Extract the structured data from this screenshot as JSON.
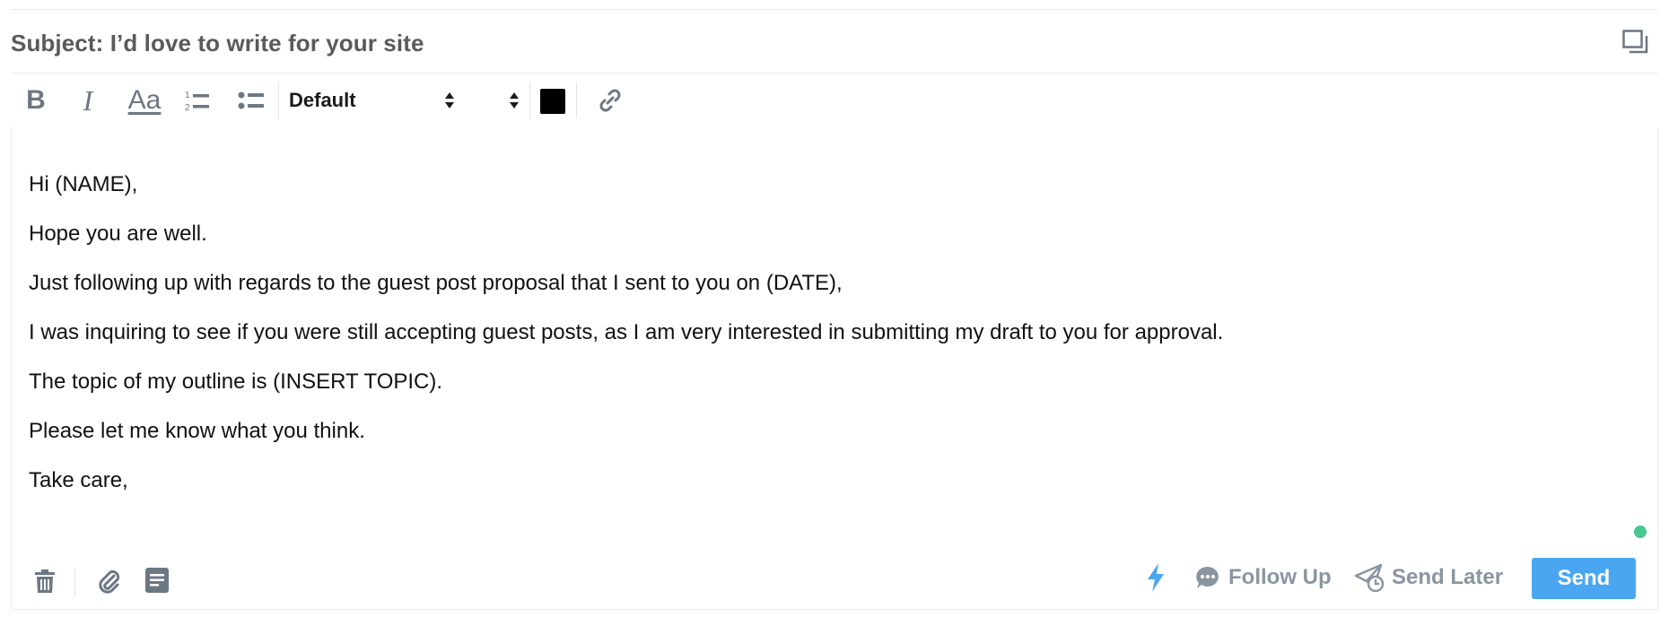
{
  "subject": {
    "text": "Subject: I’d love to write for your site"
  },
  "toolbar": {
    "bold_label": "B",
    "italic_label": "I",
    "font_size_label": "Aa",
    "font_select_value": "Default",
    "text_color": "#000000",
    "icons": [
      "bold-icon",
      "italic-icon",
      "text-size-icon",
      "ordered-list-icon",
      "bullet-list-icon",
      "link-icon"
    ]
  },
  "message": {
    "lines": [
      "Hi (NAME),",
      "Hope you are well.",
      "Just following up with regards to the guest post proposal that I sent to you on (DATE),",
      "I was inquiring to see if you were still accepting guest posts, as I am very interested in submitting my draft to you for approval.",
      "The topic of my outline is (INSERT TOPIC).",
      "Please let me know what you think.",
      "Take care,"
    ]
  },
  "footer": {
    "follow_up_label": "Follow Up",
    "send_later_label": "Send Later",
    "send_label": "Send",
    "icons": [
      "trash-icon",
      "paperclip-icon",
      "template-icon",
      "lightning-icon",
      "chat-bubble-icon",
      "paper-plane-clock-icon"
    ]
  },
  "colors": {
    "accent": "#4aa6f0",
    "muted_icon": "#6c7784",
    "status_online": "#48c78e"
  }
}
